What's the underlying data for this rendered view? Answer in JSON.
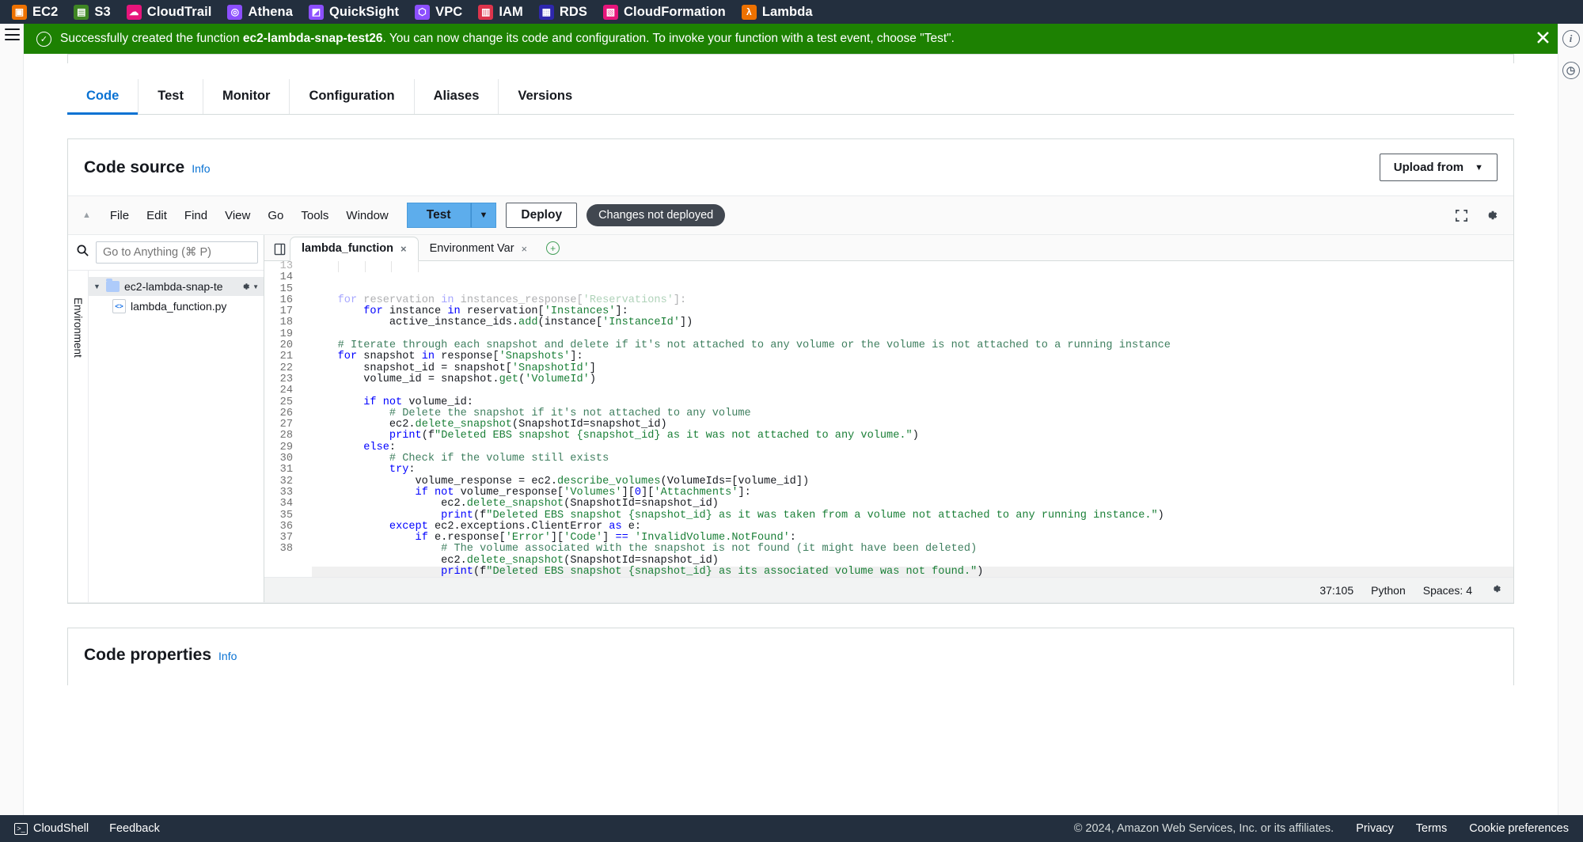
{
  "services": [
    {
      "label": "EC2",
      "icon": "ec2-icon",
      "color": "#ed7100",
      "glyph": "▣"
    },
    {
      "label": "S3",
      "icon": "s3-icon",
      "color": "#3f8624",
      "glyph": "▤"
    },
    {
      "label": "CloudTrail",
      "icon": "cloudtrail-icon",
      "color": "#e7157b",
      "glyph": "☁"
    },
    {
      "label": "Athena",
      "icon": "athena-icon",
      "color": "#8c4fff",
      "glyph": "◎"
    },
    {
      "label": "QuickSight",
      "icon": "quicksight-icon",
      "color": "#8c4fff",
      "glyph": "◩"
    },
    {
      "label": "VPC",
      "icon": "vpc-icon",
      "color": "#8c4fff",
      "glyph": "⬡"
    },
    {
      "label": "IAM",
      "icon": "iam-icon",
      "color": "#dd344c",
      "glyph": "▥"
    },
    {
      "label": "RDS",
      "icon": "rds-icon",
      "color": "#2e27ad",
      "glyph": "▦"
    },
    {
      "label": "CloudFormation",
      "icon": "cloudformation-icon",
      "color": "#e7157b",
      "glyph": "▧"
    },
    {
      "label": "Lambda",
      "icon": "lambda-icon",
      "color": "#ed7100",
      "glyph": "λ"
    }
  ],
  "banner": {
    "prefix": "Successfully created the function ",
    "function_name": "ec2-lambda-snap-test26",
    "suffix": ". You can now change its code and configuration. To invoke your function with a test event, choose \"Test\".",
    "status": "success",
    "color": "#1d8102",
    "check_icon": "check-icon",
    "close_icon": "close-icon"
  },
  "right_rail": [
    {
      "name": "info-panel-icon",
      "glyph": "i"
    },
    {
      "name": "history-clock-icon",
      "glyph": "◷"
    }
  ],
  "tabs": [
    {
      "label": "Code",
      "active": true
    },
    {
      "label": "Test",
      "active": false
    },
    {
      "label": "Monitor",
      "active": false
    },
    {
      "label": "Configuration",
      "active": false
    },
    {
      "label": "Aliases",
      "active": false
    },
    {
      "label": "Versions",
      "active": false
    }
  ],
  "code_source": {
    "title": "Code source",
    "info_label": "Info",
    "upload_button": "Upload from",
    "upload_caret": "▼"
  },
  "editor_menu": {
    "collapse_glyph": "▲",
    "items": [
      "File",
      "Edit",
      "Find",
      "View",
      "Go",
      "Tools",
      "Window"
    ],
    "test_button": "Test",
    "test_caret": "▼",
    "deploy_button": "Deploy",
    "deploy_badge": "Changes not deployed",
    "fullscreen_icon": "fullscreen-icon",
    "settings_icon": "gear-icon"
  },
  "explorer": {
    "search_placeholder": "Go to Anything (⌘ P)",
    "search_value": "",
    "search_icon": "search-icon",
    "vertical_label": "Environment",
    "folder": {
      "label": "ec2-lambda-snap-te",
      "expanded": true,
      "triangle": "▼"
    },
    "file": {
      "label": "lambda_function.py",
      "icon": "python-file-icon"
    },
    "folder_gear_icon": "gear-icon"
  },
  "editor_tabs": {
    "pane_icon": "split-pane-icon",
    "items": [
      {
        "label": "lambda_function",
        "active": true,
        "close": "×"
      },
      {
        "label": "Environment Var",
        "active": false,
        "close": "×"
      }
    ],
    "add_tab": "+"
  },
  "editor_status": {
    "cursor": "37:105",
    "language": "Python",
    "indent": "Spaces: 4",
    "settings_icon": "gear-icon"
  },
  "code": {
    "first_line": 13,
    "cursor_line": 37,
    "lines": [
      {
        "n": 13,
        "partial": true,
        "tokens": [
          {
            "t": "    ",
            "c": ""
          },
          {
            "t": "for",
            "c": "kw"
          },
          {
            "t": " reservation ",
            "c": ""
          },
          {
            "t": "in",
            "c": "kw"
          },
          {
            "t": " instances_response[",
            "c": ""
          },
          {
            "t": "'Reservations'",
            "c": "str"
          },
          {
            "t": "]:",
            "c": ""
          }
        ]
      },
      {
        "n": 14,
        "tokens": [
          {
            "t": "        ",
            "c": ""
          },
          {
            "t": "for",
            "c": "kw"
          },
          {
            "t": " instance ",
            "c": ""
          },
          {
            "t": "in",
            "c": "kw"
          },
          {
            "t": " reservation[",
            "c": ""
          },
          {
            "t": "'Instances'",
            "c": "str"
          },
          {
            "t": "]:",
            "c": ""
          }
        ]
      },
      {
        "n": 15,
        "tokens": [
          {
            "t": "            active_instance_ids.",
            "c": ""
          },
          {
            "t": "add",
            "c": "fn"
          },
          {
            "t": "(instance[",
            "c": ""
          },
          {
            "t": "'InstanceId'",
            "c": "str"
          },
          {
            "t": "])",
            "c": ""
          }
        ]
      },
      {
        "n": 16,
        "tokens": []
      },
      {
        "n": 17,
        "tokens": [
          {
            "t": "    # Iterate through each snapshot and delete if it's not attached to any volume or the volume is not attached to a running instance",
            "c": "cm"
          }
        ]
      },
      {
        "n": 18,
        "tokens": [
          {
            "t": "    ",
            "c": ""
          },
          {
            "t": "for",
            "c": "kw"
          },
          {
            "t": " snapshot ",
            "c": ""
          },
          {
            "t": "in",
            "c": "kw"
          },
          {
            "t": " response[",
            "c": ""
          },
          {
            "t": "'Snapshots'",
            "c": "str"
          },
          {
            "t": "]:",
            "c": ""
          }
        ]
      },
      {
        "n": 19,
        "tokens": [
          {
            "t": "        snapshot_id = snapshot[",
            "c": ""
          },
          {
            "t": "'SnapshotId'",
            "c": "str"
          },
          {
            "t": "]",
            "c": ""
          }
        ]
      },
      {
        "n": 20,
        "tokens": [
          {
            "t": "        volume_id = snapshot.",
            "c": ""
          },
          {
            "t": "get",
            "c": "fn"
          },
          {
            "t": "(",
            "c": ""
          },
          {
            "t": "'VolumeId'",
            "c": "str"
          },
          {
            "t": ")",
            "c": ""
          }
        ]
      },
      {
        "n": 21,
        "tokens": []
      },
      {
        "n": 22,
        "tokens": [
          {
            "t": "        ",
            "c": ""
          },
          {
            "t": "if not",
            "c": "kw"
          },
          {
            "t": " volume_id:",
            "c": ""
          }
        ]
      },
      {
        "n": 23,
        "tokens": [
          {
            "t": "            # Delete the snapshot if it's not attached to any volume",
            "c": "cm"
          }
        ]
      },
      {
        "n": 24,
        "tokens": [
          {
            "t": "            ec2.",
            "c": ""
          },
          {
            "t": "delete_snapshot",
            "c": "fn"
          },
          {
            "t": "(SnapshotId=snapshot_id)",
            "c": ""
          }
        ]
      },
      {
        "n": 25,
        "tokens": [
          {
            "t": "            ",
            "c": ""
          },
          {
            "t": "print",
            "c": "kw"
          },
          {
            "t": "(f",
            "c": ""
          },
          {
            "t": "\"Deleted EBS snapshot {snapshot_id} as it was not attached to any volume.\"",
            "c": "str"
          },
          {
            "t": ")",
            "c": ""
          }
        ]
      },
      {
        "n": 26,
        "tokens": [
          {
            "t": "        ",
            "c": ""
          },
          {
            "t": "else",
            "c": "kw"
          },
          {
            "t": ":",
            "c": ""
          }
        ]
      },
      {
        "n": 27,
        "tokens": [
          {
            "t": "            # Check if the volume still exists",
            "c": "cm"
          }
        ]
      },
      {
        "n": 28,
        "tokens": [
          {
            "t": "            ",
            "c": ""
          },
          {
            "t": "try",
            "c": "kw"
          },
          {
            "t": ":",
            "c": ""
          }
        ]
      },
      {
        "n": 29,
        "tokens": [
          {
            "t": "                volume_response = ec2.",
            "c": ""
          },
          {
            "t": "describe_volumes",
            "c": "fn"
          },
          {
            "t": "(VolumeIds=[volume_id])",
            "c": ""
          }
        ]
      },
      {
        "n": 30,
        "tokens": [
          {
            "t": "                ",
            "c": ""
          },
          {
            "t": "if not",
            "c": "kw"
          },
          {
            "t": " volume_response[",
            "c": ""
          },
          {
            "t": "'Volumes'",
            "c": "str"
          },
          {
            "t": "][",
            "c": ""
          },
          {
            "t": "0",
            "c": "num"
          },
          {
            "t": "][",
            "c": ""
          },
          {
            "t": "'Attachments'",
            "c": "str"
          },
          {
            "t": "]:",
            "c": ""
          }
        ]
      },
      {
        "n": 31,
        "tokens": [
          {
            "t": "                    ec2.",
            "c": ""
          },
          {
            "t": "delete_snapshot",
            "c": "fn"
          },
          {
            "t": "(SnapshotId=snapshot_id)",
            "c": ""
          }
        ]
      },
      {
        "n": 32,
        "tokens": [
          {
            "t": "                    ",
            "c": ""
          },
          {
            "t": "print",
            "c": "kw"
          },
          {
            "t": "(f",
            "c": ""
          },
          {
            "t": "\"Deleted EBS snapshot {snapshot_id} as it was taken from a volume not attached to any running instance.\"",
            "c": "str"
          },
          {
            "t": ")",
            "c": ""
          }
        ]
      },
      {
        "n": 33,
        "tokens": [
          {
            "t": "            ",
            "c": ""
          },
          {
            "t": "except",
            "c": "kw"
          },
          {
            "t": " ec2.exceptions.ClientError ",
            "c": ""
          },
          {
            "t": "as",
            "c": "kw"
          },
          {
            "t": " e:",
            "c": ""
          }
        ]
      },
      {
        "n": 34,
        "tokens": [
          {
            "t": "                ",
            "c": ""
          },
          {
            "t": "if",
            "c": "kw"
          },
          {
            "t": " e.response[",
            "c": ""
          },
          {
            "t": "'Error'",
            "c": "str"
          },
          {
            "t": "][",
            "c": ""
          },
          {
            "t": "'Code'",
            "c": "str"
          },
          {
            "t": "] ",
            "c": ""
          },
          {
            "t": "==",
            "c": "kw"
          },
          {
            "t": " ",
            "c": ""
          },
          {
            "t": "'InvalidVolume.NotFound'",
            "c": "str"
          },
          {
            "t": ":",
            "c": ""
          }
        ]
      },
      {
        "n": 35,
        "tokens": [
          {
            "t": "                    # The volume associated with the snapshot is not found (it might have been deleted)",
            "c": "cm"
          }
        ]
      },
      {
        "n": 36,
        "tokens": [
          {
            "t": "                    ec2.",
            "c": ""
          },
          {
            "t": "delete_snapshot",
            "c": "fn"
          },
          {
            "t": "(SnapshotId=snapshot_id)",
            "c": ""
          }
        ]
      },
      {
        "n": 37,
        "tokens": [
          {
            "t": "                    ",
            "c": ""
          },
          {
            "t": "print",
            "c": "kw"
          },
          {
            "t": "(f",
            "c": ""
          },
          {
            "t": "\"Deleted EBS snapshot {snapshot_id} as its associated volume was not found.\"",
            "c": "str"
          },
          {
            "t": ")",
            "c": ""
          }
        ]
      },
      {
        "n": 38,
        "tokens": []
      }
    ]
  },
  "code_properties": {
    "title": "Code properties",
    "info_label": "Info"
  },
  "footer": {
    "cloudshell": "CloudShell",
    "feedback": "Feedback",
    "copyright": "© 2024, Amazon Web Services, Inc. or its affiliates.",
    "links": [
      "Privacy",
      "Terms",
      "Cookie preferences"
    ]
  }
}
